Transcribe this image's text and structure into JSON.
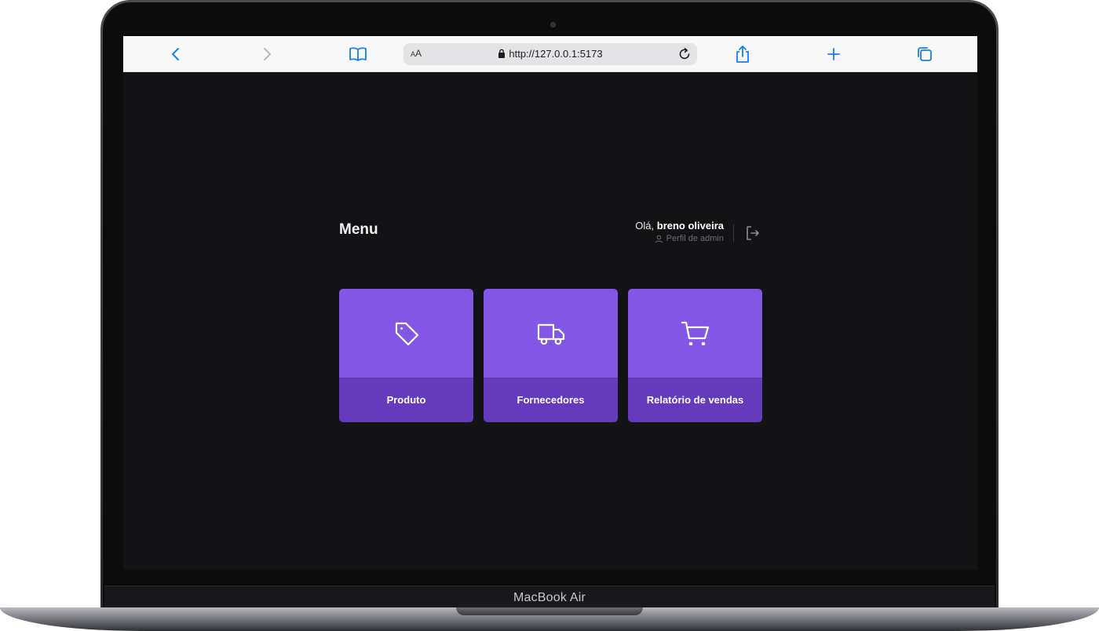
{
  "device": {
    "brand_label": "MacBook Air"
  },
  "browser": {
    "text_size_button": "AA",
    "url": "http://127.0.0.1:5173",
    "icons": {
      "back": "chevron-left-icon",
      "forward": "chevron-right-icon",
      "bookmarks": "book-icon",
      "lock": "lock-icon",
      "reload": "reload-icon",
      "share": "share-icon",
      "new_tab": "plus-icon",
      "tabs": "tabs-icon"
    },
    "accent_color": "#1a7cf0"
  },
  "app": {
    "title": "Menu",
    "user": {
      "greeting_prefix": "Olá, ",
      "name": "breno oliveira",
      "profile_label": "Perfil de admin"
    },
    "icons": {
      "profile": "user-icon",
      "logout": "logout-icon"
    },
    "cards": [
      {
        "label": "Produto",
        "icon": "tag-icon"
      },
      {
        "label": "Fornecedores",
        "icon": "truck-icon"
      },
      {
        "label": "Relatório de vendas",
        "icon": "cart-icon"
      }
    ],
    "colors": {
      "background": "#131315",
      "card_top": "#8257e5",
      "card_bottom": "#633bbc"
    }
  }
}
